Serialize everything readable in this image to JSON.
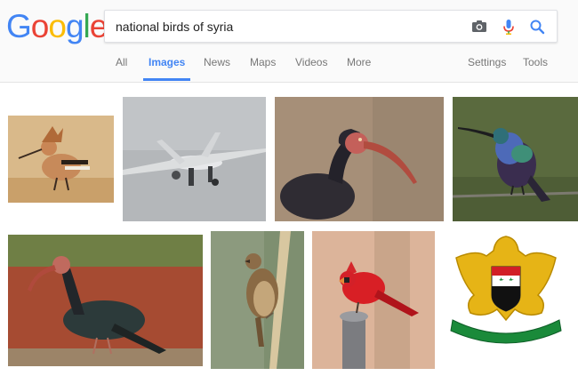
{
  "logo": {
    "letters": [
      "G",
      "o",
      "o",
      "g",
      "l",
      "e"
    ],
    "colors": [
      "#4285f4",
      "#ea4335",
      "#fbbc05",
      "#4285f4",
      "#34a853",
      "#ea4335"
    ]
  },
  "search": {
    "query": "national birds of syria",
    "icons": [
      "camera-icon",
      "microphone-icon",
      "search-icon"
    ]
  },
  "tabs": {
    "all": "All",
    "images": "Images",
    "news": "News",
    "maps": "Maps",
    "videos": "Videos",
    "more": "More",
    "settings": "Settings",
    "tools": "Tools",
    "active": "Images"
  },
  "colors": {
    "accent": "#4285f4",
    "tab_text": "#777777",
    "header_bg": "#fafafa"
  },
  "results": [
    {
      "subject": "hoopoe bird"
    },
    {
      "subject": "military drone"
    },
    {
      "subject": "northern bald ibis"
    },
    {
      "subject": "sunbird"
    },
    {
      "subject": "northern bald ibis standing"
    },
    {
      "subject": "reed warbler on reed"
    },
    {
      "subject": "red cardinal on post"
    },
    {
      "subject": "coat of arms of syria"
    }
  ]
}
